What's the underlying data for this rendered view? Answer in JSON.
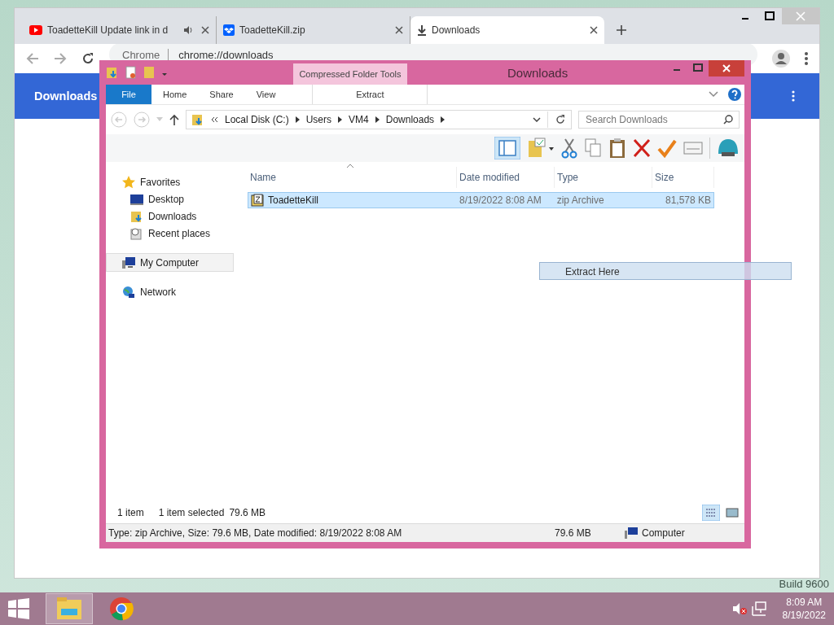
{
  "browser": {
    "tabs": [
      {
        "title": "ToadetteKill Update link in d",
        "kind": "video",
        "selected": false,
        "audio": true
      },
      {
        "title": "ToadetteKill.zip",
        "kind": "box",
        "selected": false,
        "audio": false
      },
      {
        "title": "Downloads",
        "kind": "download",
        "selected": true,
        "audio": false
      }
    ],
    "omnibox": {
      "chip": "Chrome",
      "url": "chrome://downloads"
    },
    "page_header": {
      "title": "Downloads"
    }
  },
  "explorer": {
    "title": "Downloads",
    "contextual_group": "Compressed Folder Tools",
    "ribbon_tabs": [
      {
        "label": "File",
        "kind": "file",
        "selected": false
      },
      {
        "label": "Home",
        "kind": "plain",
        "selected": false
      },
      {
        "label": "Share",
        "kind": "plain",
        "selected": false
      },
      {
        "label": "View",
        "kind": "plain",
        "selected": false
      },
      {
        "label": "Extract",
        "kind": "contextual",
        "selected": false
      }
    ],
    "breadcrumb": [
      "Local Disk (C:)",
      "Users",
      "VM4",
      "Downloads"
    ],
    "search": {
      "placeholder": "Search Downloads"
    },
    "nav": [
      {
        "label": "Favorites",
        "kind": "star",
        "selected": false,
        "children": [
          {
            "label": "Desktop",
            "kind": "desktop",
            "selected": false
          },
          {
            "label": "Downloads",
            "kind": "downloads",
            "selected": false
          },
          {
            "label": "Recent places",
            "kind": "recent",
            "selected": false
          }
        ]
      },
      {
        "label": "My Computer",
        "kind": "computer",
        "selected": true
      },
      {
        "label": "Network",
        "kind": "network",
        "selected": false
      }
    ],
    "columns": [
      "Name",
      "Date modified",
      "Type",
      "Size"
    ],
    "rows": [
      {
        "name": "ToadetteKill",
        "date": "8/19/2022 8:08 AM",
        "type": "zip Archive",
        "size": "81,578 KB",
        "selected": true
      }
    ],
    "status": {
      "count": "1 item",
      "selection": "1 item selected",
      "selection_size": "79.6 MB"
    },
    "details_bar": {
      "info": "Type: zip Archive, Size: 79.6 MB, Date modified: 8/19/2022 8:08 AM",
      "size": "79.6 MB",
      "location": "Computer"
    }
  },
  "drag_tooltip": "Extract Here",
  "desktop_text": "Build 9600",
  "taskbar": {
    "apps": [
      {
        "kind": "explorer",
        "selected": true
      },
      {
        "kind": "chrome",
        "selected": false
      }
    ],
    "clock": {
      "time": "8:09 AM",
      "date": "8/19/2022"
    }
  }
}
